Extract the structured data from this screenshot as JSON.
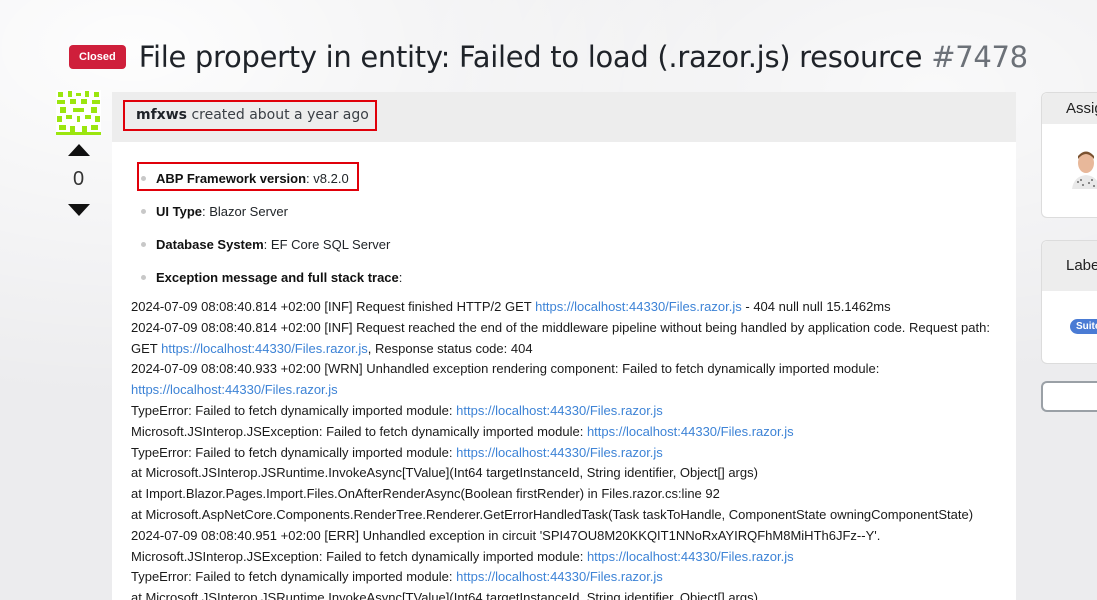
{
  "issue": {
    "status_badge": "Closed",
    "title": "File property in entity: Failed to load (.razor.js) resource",
    "number": "#7478",
    "author": "mfxws",
    "created_text": "created about a year ago",
    "vote_count": "0"
  },
  "body": {
    "fields": [
      {
        "label": "ABP Framework version",
        "value": ": v8.2.0"
      },
      {
        "label": "UI Type",
        "value": ": Blazor Server"
      },
      {
        "label": "Database System",
        "value": ": EF Core SQL Server"
      },
      {
        "label": "Exception message and full stack trace",
        "value": ":"
      }
    ],
    "log": [
      {
        "t1": "2024-07-09 08:08:40.814 +02:00 [INF] Request finished HTTP/2 GET ",
        "link": "https://localhost:44330/Files.razor.js",
        "t2": " - 404 null null 15.1462ms"
      },
      {
        "t1": "2024-07-09 08:08:40.814 +02:00 [INF] Request reached the end of the middleware pipeline without being handled by application code. Request path:",
        "link": "",
        "t2": ""
      },
      {
        "t1": "GET ",
        "link": "https://localhost:44330/Files.razor.js",
        "t2": ", Response status code: 404"
      },
      {
        "t1": "2024-07-09 08:08:40.933 +02:00 [WRN] Unhandled exception rendering component: Failed to fetch dynamically imported module:",
        "link": "",
        "t2": ""
      },
      {
        "t1": "",
        "link": "https://localhost:44330/Files.razor.js",
        "t2": ""
      },
      {
        "t1": "TypeError: Failed to fetch dynamically imported module: ",
        "link": "https://localhost:44330/Files.razor.js",
        "t2": ""
      },
      {
        "t1": "Microsoft.JSInterop.JSException: Failed to fetch dynamically imported module: ",
        "link": "https://localhost:44330/Files.razor.js",
        "t2": ""
      },
      {
        "t1": "TypeError: Failed to fetch dynamically imported module: ",
        "link": "https://localhost:44330/Files.razor.js",
        "t2": ""
      },
      {
        "t1": "at Microsoft.JSInterop.JSRuntime.InvokeAsync[TValue](Int64 targetInstanceId, String identifier, Object[] args)",
        "link": "",
        "t2": ""
      },
      {
        "t1": "at Import.Blazor.Pages.Import.Files.OnAfterRenderAsync(Boolean firstRender) in Files.razor.cs:line 92",
        "link": "",
        "t2": ""
      },
      {
        "t1": "at Microsoft.AspNetCore.Components.RenderTree.Renderer.GetErrorHandledTask(Task taskToHandle, ComponentState owningComponentState)",
        "link": "",
        "t2": ""
      },
      {
        "t1": "2024-07-09 08:08:40.951 +02:00 [ERR] Unhandled exception in circuit 'SPI47OU8M20KKQIT1NNoRxAYIRQFhM8MiHTh6JFz--Y'.",
        "link": "",
        "t2": ""
      },
      {
        "t1": "Microsoft.JSInterop.JSException: Failed to fetch dynamically imported module: ",
        "link": "https://localhost:44330/Files.razor.js",
        "t2": ""
      },
      {
        "t1": "TypeError: Failed to fetch dynamically imported module: ",
        "link": "https://localhost:44330/Files.razor.js",
        "t2": ""
      },
      {
        "t1": "at Microsoft.JSInterop.JSRuntime.InvokeAsync[TValue](Int64 targetInstanceId, String identifier, Object[] args)",
        "link": "",
        "t2": ""
      }
    ]
  },
  "sidebar": {
    "assignees_heading": "Assignees",
    "labels_heading": "Labels",
    "label_pill": "Suite"
  },
  "colors": {
    "closed_badge": "#cf1f3b",
    "link": "#3d83d6",
    "highlight_border": "#e0000a"
  }
}
